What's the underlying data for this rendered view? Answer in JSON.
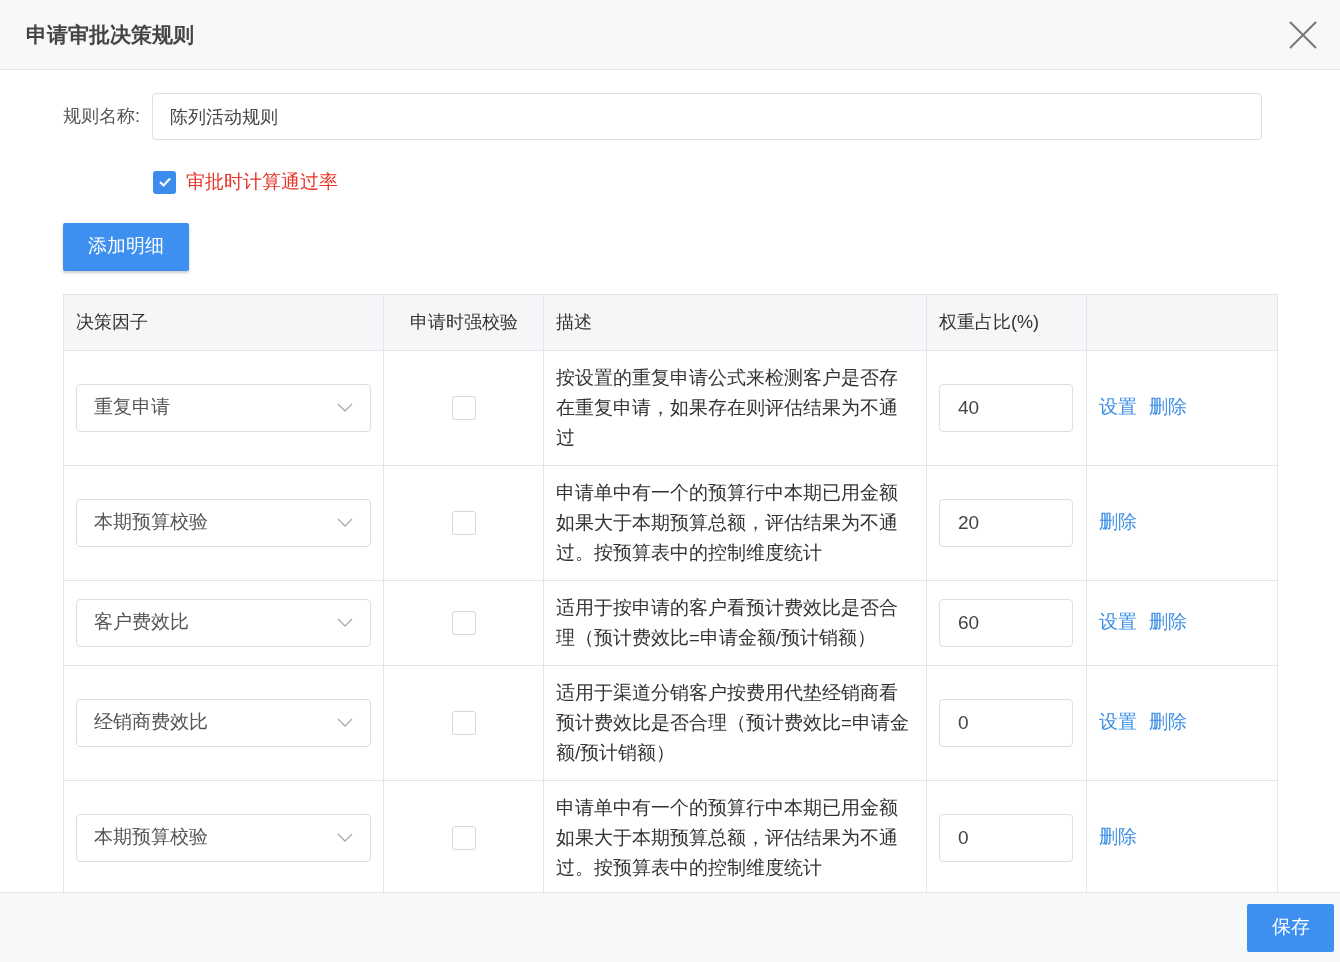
{
  "dialog": {
    "title": "申请审批决策规则"
  },
  "form": {
    "name_label": "规则名称:",
    "name_value": "陈列活动规则",
    "calc_pass_rate": {
      "label": "审批时计算通过率",
      "checked": true
    }
  },
  "add_button": "添加明细",
  "table": {
    "columns": [
      "决策因子",
      "申请时强校验",
      "描述",
      "权重占比(%)"
    ],
    "rows": [
      {
        "factor": "重复申请",
        "strong_check": false,
        "description": "按设置的重复申请公式来检测客户是否存在重复申请，如果存在则评估结果为不通过",
        "weight": "40",
        "actions": [
          "设置",
          "删除"
        ]
      },
      {
        "factor": "本期预算校验",
        "strong_check": false,
        "description": "申请单中有一个的预算行中本期已用金额如果大于本期预算总额，评估结果为不通过。按预算表中的控制维度统计",
        "weight": "20",
        "actions": [
          "删除"
        ]
      },
      {
        "factor": "客户费效比",
        "strong_check": false,
        "description": "适用于按申请的客户看预计费效比是否合理（预计费效比=申请金额/预计销额）",
        "weight": "60",
        "actions": [
          "设置",
          "删除"
        ]
      },
      {
        "factor": "经销商费效比",
        "strong_check": false,
        "description": "适用于渠道分销客户按费用代垫经销商看预计费效比是否合理（预计费效比=申请金额/预计销额）",
        "weight": "0",
        "actions": [
          "设置",
          "删除"
        ]
      },
      {
        "factor": "本期预算校验",
        "strong_check": false,
        "description": "申请单中有一个的预算行中本期已用金额如果大于本期预算总额，评估结果为不通过。按预算表中的控制维度统计",
        "weight": "0",
        "actions": [
          "删除"
        ]
      }
    ]
  },
  "footer": {
    "save_button": "保存"
  }
}
